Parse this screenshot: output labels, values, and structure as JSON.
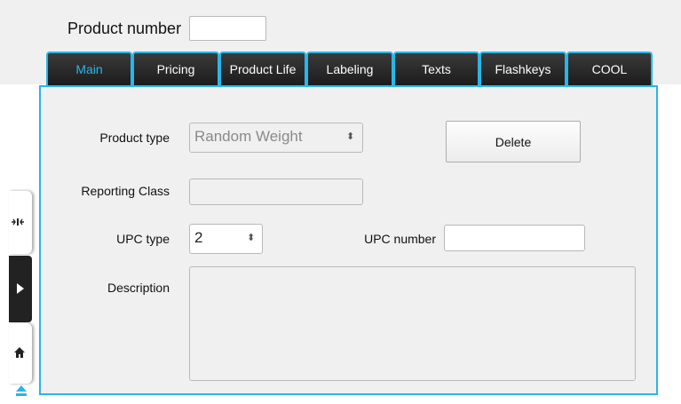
{
  "header": {
    "product_number_label": "Product number",
    "product_number_value": ""
  },
  "tabs": [
    {
      "label": "Main",
      "active": true
    },
    {
      "label": "Pricing",
      "active": false
    },
    {
      "label": "Product Life",
      "active": false
    },
    {
      "label": "Labeling",
      "active": false
    },
    {
      "label": "Texts",
      "active": false
    },
    {
      "label": "Flashkeys",
      "active": false
    },
    {
      "label": "COOL",
      "active": false
    }
  ],
  "form": {
    "product_type": {
      "label": "Product type",
      "value": "Random Weight"
    },
    "reporting_class": {
      "label": "Reporting Class",
      "value": ""
    },
    "upc_type": {
      "label": "UPC type",
      "value": "2"
    },
    "upc_number": {
      "label": "UPC number",
      "value": ""
    },
    "description": {
      "label": "Description",
      "value": ""
    },
    "delete_label": "Delete"
  },
  "side_nav": {
    "icons": [
      "scale-icon",
      "play-icon",
      "home-icon",
      "eject-icon"
    ]
  },
  "colors": {
    "accent": "#29b6e8",
    "tab_background": "#2a2a2a",
    "panel_background": "#f0f0f0"
  }
}
